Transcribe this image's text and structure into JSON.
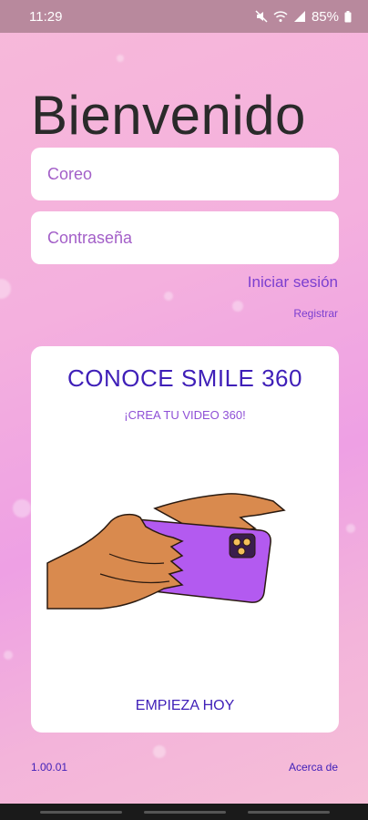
{
  "status_bar": {
    "time": "11:29",
    "battery": "85%",
    "icons": [
      "mute-icon",
      "wifi-icon",
      "signal-icon",
      "battery-icon"
    ]
  },
  "login": {
    "title": "Bienvenido",
    "email_placeholder": "Coreo",
    "password_placeholder": "Contraseña",
    "login_label": "Iniciar sesión",
    "register_label": "Registrar"
  },
  "promo": {
    "title": "CONOCE SMILE 360",
    "subtitle": "¡CREA TU VIDEO 360!",
    "cta_label": "EMPIEZA HOY"
  },
  "footer": {
    "version": "1.00.01",
    "about_label": "Acerca de"
  },
  "colors": {
    "accent": "#7b3fd0",
    "heading": "#3f1fb8",
    "placeholder": "#a35fc8",
    "phone": "#b35af0",
    "skin": "#d98a4e"
  }
}
